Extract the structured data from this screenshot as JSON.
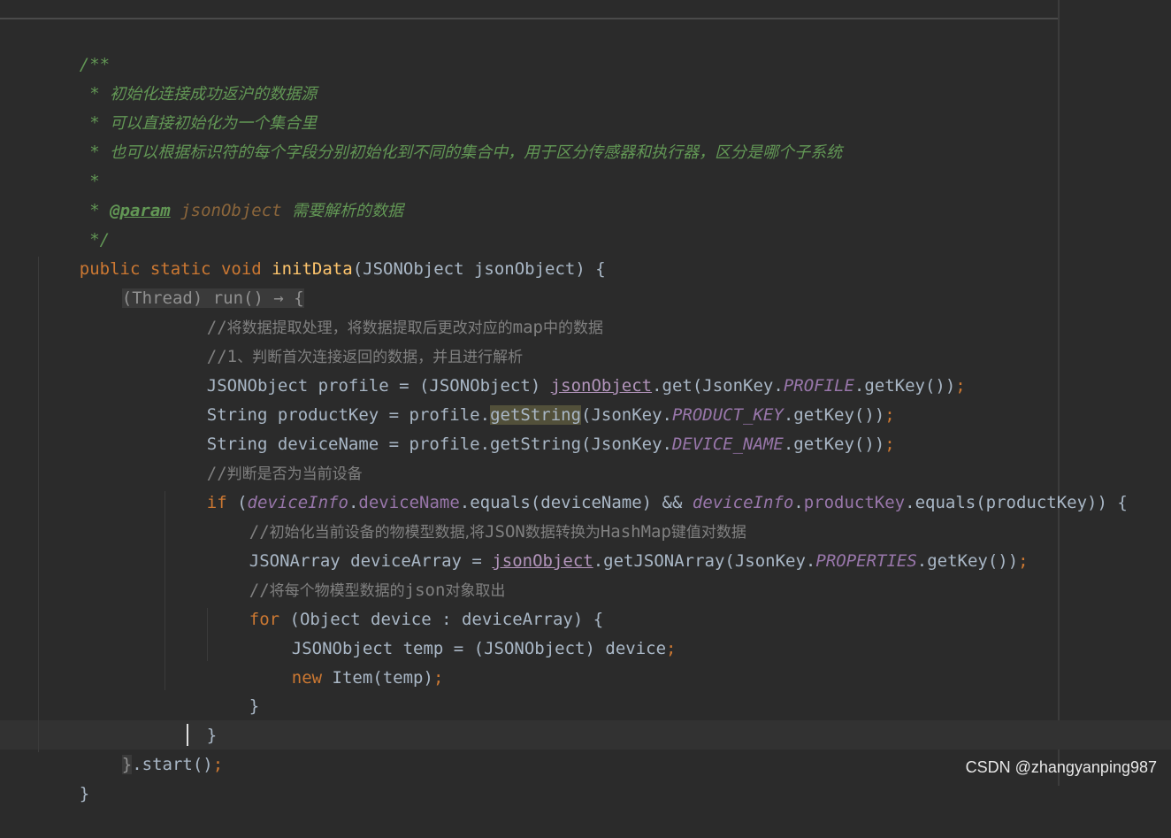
{
  "watermark": "CSDN @zhangyanping987",
  "code": {
    "doc_open": "/**",
    "doc_star": " * ",
    "doc_line1": "初始化连接成功返沪的数据源",
    "doc_line2": "可以直接初始化为一个集合里",
    "doc_line3": "也可以根据标识符的每个字段分别初始化到不同的集合中，用于区分传感器和执行器，区分是哪个子系统",
    "doc_empty": " *",
    "doc_param_tag": "@param",
    "doc_param_name": "jsonObject",
    "doc_param_desc": "需要解析的数据",
    "doc_close": " */",
    "kw_public": "public",
    "kw_static": "static",
    "kw_void": "void",
    "method_name": "initData",
    "method_params": "(JSONObject jsonObject) {",
    "lambda_hint": "(Thread) run() → {",
    "comment1_prefix": "//",
    "comment1_a": "将数据提取处理，将数据提取后更改对应的",
    "comment1_map": "map",
    "comment1_b": "中的数据",
    "comment2_prefix": "//1",
    "comment2_text": "、判断首次连接返回的数据，并且进行解析",
    "line_profile_a": "JSONObject profile = (JSONObject) ",
    "line_profile_var": "jsonObject",
    "line_profile_b": ".get(JsonKey.",
    "line_profile_const": "PROFILE",
    "line_profile_c": ".getKey())",
    "semicolon": ";",
    "line_pk_a": "String productKey = profile.",
    "line_pk_hl": "getString",
    "line_pk_b": "(JsonKey.",
    "line_pk_const": "PRODUCT_KEY",
    "line_pk_c": ".getKey())",
    "line_dn_a": "String deviceName = profile.getString(JsonKey.",
    "line_dn_const": "DEVICE_NAME",
    "line_dn_c": ".getKey())",
    "comment3_prefix": "//",
    "comment3_text": "判断是否为当前设备",
    "kw_if": "if",
    "if_a": " (",
    "if_devinfo1": "deviceInfo",
    "if_dot1": ".",
    "if_field1": "deviceName",
    "if_b": ".equals(deviceName) && ",
    "if_devinfo2": "deviceInfo",
    "if_dot2": ".",
    "if_field2": "productKey",
    "if_c": ".equals(productKey)) {",
    "comment4_prefix": "//",
    "comment4_a": "初始化当前设备的物模型数据,将",
    "comment4_json": "JSON",
    "comment4_b": "数据转换为",
    "comment4_hashmap": "HashMap",
    "comment4_c": "键值对数据",
    "line_arr_a": "JSONArray deviceArray = ",
    "line_arr_var": "jsonObject",
    "line_arr_b": ".getJSONArray(JsonKey.",
    "line_arr_const": "PROPERTIES",
    "line_arr_c": ".getKey())",
    "comment5_prefix": "//",
    "comment5_a": "将每个物模型数据的",
    "comment5_json": "json",
    "comment5_b": "对象取出",
    "kw_for": "for",
    "for_rest": " (Object device : deviceArray) {",
    "line_temp": "JSONObject temp = (JSONObject) device",
    "kw_new": "new",
    "line_item": " Item(temp)",
    "close_brace": "}",
    "start_brace": "}",
    "start_call": ".start()"
  }
}
